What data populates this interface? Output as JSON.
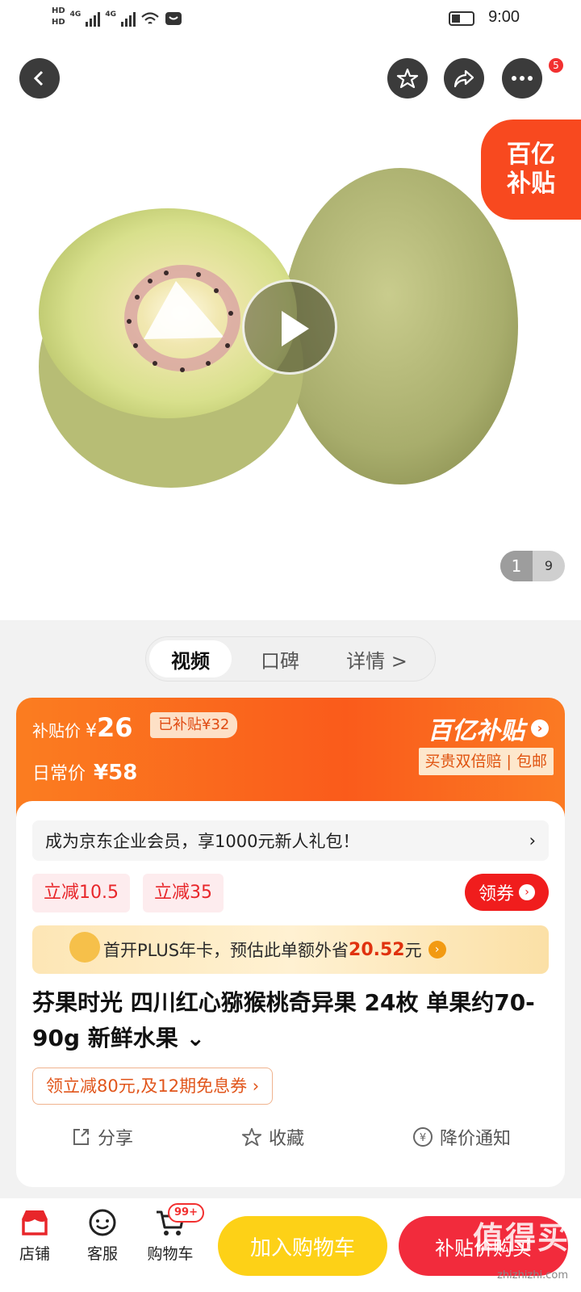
{
  "status_bar": {
    "hd1": "HD",
    "hd2": "HD",
    "net1": "4G",
    "net2": "4G",
    "time": "9:00"
  },
  "hero": {
    "more_badge": "5",
    "subsidy_tag_line1": "百亿",
    "subsidy_tag_line2": "补贴",
    "pager_current": "1",
    "pager_total": "9"
  },
  "tabs": [
    {
      "label": "视频"
    },
    {
      "label": "口碑"
    },
    {
      "label": "详情 >"
    }
  ],
  "price": {
    "subsidy_label": "补贴价",
    "currency": "¥",
    "subsidy_price": "26",
    "saved": "已补贴¥32",
    "daily_label": "日常价",
    "daily_price": "¥58",
    "brand": "百亿补贴",
    "guarantee": "买贵双倍赔 | 包邮"
  },
  "member": {
    "text": "成为京东企业会员，享1000元新人礼包！",
    "chevron": "›"
  },
  "coupons": [
    {
      "label": "立减10.5"
    },
    {
      "label": "立减35"
    }
  ],
  "get_coupon": "领券",
  "plus": {
    "prefix": "首开PLUS年卡，预估此单额外省",
    "amount": "20.52",
    "suffix": "元"
  },
  "product": {
    "title": "芬果时光 四川红心猕猴桃奇异果 24枚 单果约70-90g 新鲜水果 ⌄"
  },
  "promo": "领立减80元,及12期免息券 ›",
  "actions": {
    "share": "分享",
    "favorite": "收藏",
    "price_alert": "降价通知"
  },
  "bottom": {
    "store": "店铺",
    "service": "客服",
    "cart": "购物车",
    "cart_badge": "99+",
    "add_cart": "加入购物车",
    "buy": "补贴价购买",
    "watermark": "值得买",
    "watermark_url": "zhizhizhi.com"
  },
  "colors": {
    "accent_red": "#f22b3c",
    "accent_orange": "#fa5b1b",
    "cart_yellow": "#fdd117"
  }
}
